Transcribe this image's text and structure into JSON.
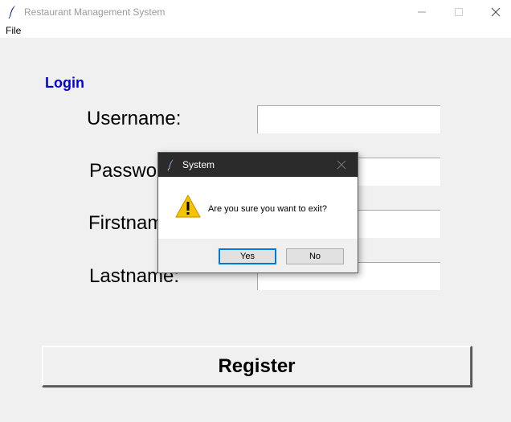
{
  "window": {
    "title": "Restaurant Management System",
    "menu": [
      "File"
    ]
  },
  "form": {
    "heading": "Login",
    "fields": [
      {
        "label": "Username:",
        "value": ""
      },
      {
        "label": "Password:",
        "value": ""
      },
      {
        "label": "Firstname:",
        "value": ""
      },
      {
        "label": "Lastname:",
        "value": ""
      }
    ],
    "register_label": "Register"
  },
  "dialog": {
    "title": "System",
    "message": "Are you sure you want to exit?",
    "icon": "warning-icon",
    "yes_label": "Yes",
    "no_label": "No"
  },
  "colors": {
    "heading": "#0000dd",
    "dialog_titlebar": "#2b2b2b",
    "focus_border": "#0078d7",
    "warning_fill": "#f5c400"
  }
}
